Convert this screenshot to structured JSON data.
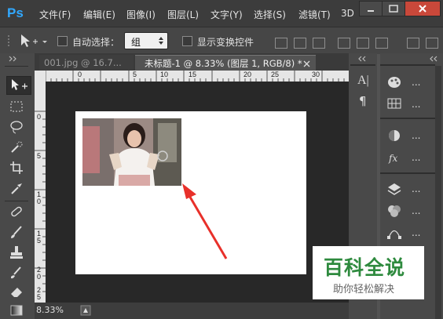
{
  "app": {
    "logo_text": "Ps"
  },
  "menu": [
    "文件(F)",
    "编辑(E)",
    "图像(I)",
    "图层(L)",
    "文字(Y)",
    "选择(S)",
    "滤镜(T)",
    "3D"
  ],
  "options_bar": {
    "auto_select_label": "自动选择：",
    "auto_select_value": "组",
    "show_transform_label": "显示变换控件"
  },
  "tabs": [
    {
      "label": "001.jpg @ 16.7...",
      "active": false
    },
    {
      "label": "未标题-1 @ 8.33% (图层 1, RGB/8) *",
      "active": true
    }
  ],
  "ruler": {
    "horizontal": [
      "0",
      "5",
      "10",
      "15",
      "20",
      "25",
      "30"
    ],
    "vertical": [
      "0",
      "5",
      "1 0",
      "1 5",
      "2 0",
      "2 5"
    ]
  },
  "status": {
    "zoom": "8.33%"
  },
  "panel_side_text": [
    "A|",
    "¶"
  ],
  "right_panel_labels": [
    "...",
    "...",
    "...",
    "...",
    "...",
    "...",
    "..."
  ],
  "watermark": {
    "title": "百科全说",
    "subtitle": "助你轻松解决"
  },
  "colors": {
    "accent": "#31a8ff",
    "arrow": "#e8302a",
    "watermark_green": "#2e8a3e"
  }
}
